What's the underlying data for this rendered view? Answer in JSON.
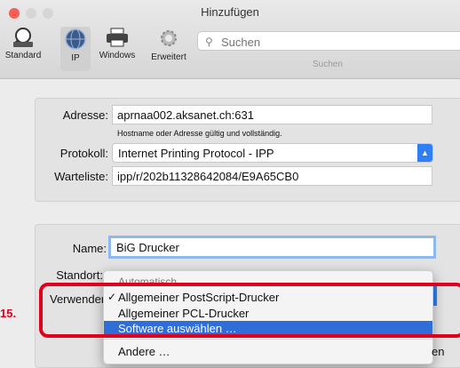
{
  "window": {
    "title": "Hinzufügen"
  },
  "toolbar": {
    "items": [
      {
        "label": "Standard",
        "icon": "printer-icon"
      },
      {
        "label": "IP",
        "icon": "globe-icon"
      },
      {
        "label": "Windows",
        "icon": "windows-printer-icon"
      },
      {
        "label": "Erweitert",
        "icon": "gear-icon"
      }
    ],
    "search_placeholder": "Suchen",
    "search_label": "Suchen"
  },
  "form": {
    "address_label": "Adresse:",
    "address_value": "aprnaa002.aksanet.ch:631",
    "address_hint": "Hostname oder Adresse gültig und vollständig.",
    "protocol_label": "Protokoll:",
    "protocol_value": "Internet Printing Protocol - IPP",
    "queue_label": "Warteliste:",
    "queue_value": "ipp/r/202b11328642084/E9A65CB0",
    "name_label": "Name:",
    "name_value": "BiG Drucker",
    "location_label": "Standort:",
    "use_label": "Verwenden"
  },
  "dropdown": {
    "partial_item": "Automatisch",
    "items": [
      {
        "label": "Allgemeiner PostScript-Drucker",
        "checked": true,
        "selected": false
      },
      {
        "label": "Allgemeiner PCL-Drucker",
        "checked": false,
        "selected": false
      },
      {
        "label": "Software auswählen …",
        "checked": false,
        "selected": true
      },
      {
        "label": "Andere …",
        "checked": false,
        "selected": false
      }
    ]
  },
  "annotation": {
    "step": "15."
  },
  "buttons": {
    "add_partial": "en"
  },
  "colors": {
    "accent": "#2f7ff4",
    "highlight": "#2f6ed8",
    "annotation": "#e0001b"
  }
}
